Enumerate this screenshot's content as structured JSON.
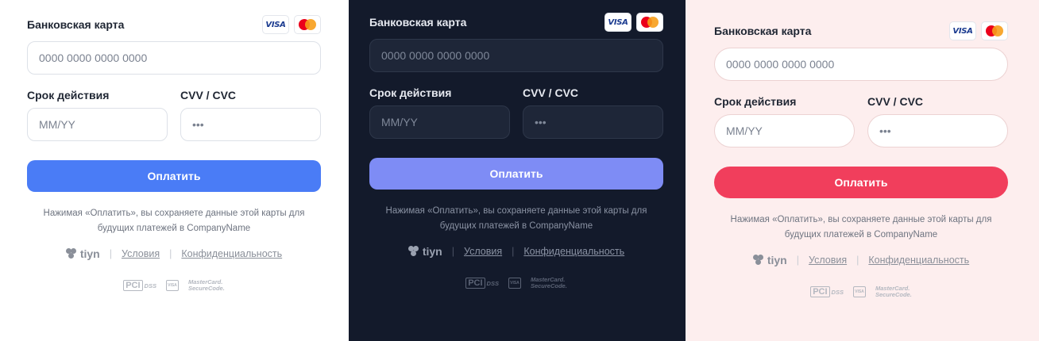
{
  "panels": [
    {
      "theme": "light",
      "card_label": "Банковская карта",
      "card_placeholder": "0000 0000 0000 0000",
      "expiry_label": "Срок действия",
      "expiry_placeholder": "MM/YY",
      "cvv_label": "CVV / CVC",
      "cvv_placeholder": "•••",
      "pay_label": "Оплатить",
      "note": "Нажимая «Оплатить», вы сохраняете данные этой карты для будущих платежей в CompanyName",
      "brand_name": "tiyn",
      "terms_link": "Условия",
      "privacy_link": "Конфиденциальность",
      "accent": "#4a7cf6"
    },
    {
      "theme": "dark",
      "card_label": "Банковская карта",
      "card_placeholder": "0000 0000 0000 0000",
      "expiry_label": "Срок действия",
      "expiry_placeholder": "MM/YY",
      "cvv_label": "CVV / CVC",
      "cvv_placeholder": "•••",
      "pay_label": "Оплатить",
      "note": "Нажимая «Оплатить», вы сохраняете данные этой карты для будущих платежей в CompanyName",
      "brand_name": "tiyn",
      "terms_link": "Условия",
      "privacy_link": "Конфиденциальность",
      "accent": "#7e8cf5"
    },
    {
      "theme": "pink",
      "card_label": "Банковская карта",
      "card_placeholder": "0000 0000 0000 0000",
      "expiry_label": "Срок действия",
      "expiry_placeholder": "MM/YY",
      "cvv_label": "CVV / CVC",
      "cvv_placeholder": "•••",
      "pay_label": "Оплатить",
      "note": "Нажимая «Оплатить», вы сохраняете данные этой карты для будущих платежей в CompanyName",
      "brand_name": "tiyn",
      "terms_link": "Условия",
      "privacy_link": "Конфиденциальность",
      "accent": "#f13e5c"
    }
  ],
  "card_brands": {
    "visa": "VISA",
    "mastercard_icon": "mastercard-icon"
  },
  "seals": {
    "pci": "PCI",
    "pci_sub": "DSS",
    "visa_small": "VISA",
    "mc_secure_line1": "MasterCard.",
    "mc_secure_line2": "SecureCode."
  }
}
